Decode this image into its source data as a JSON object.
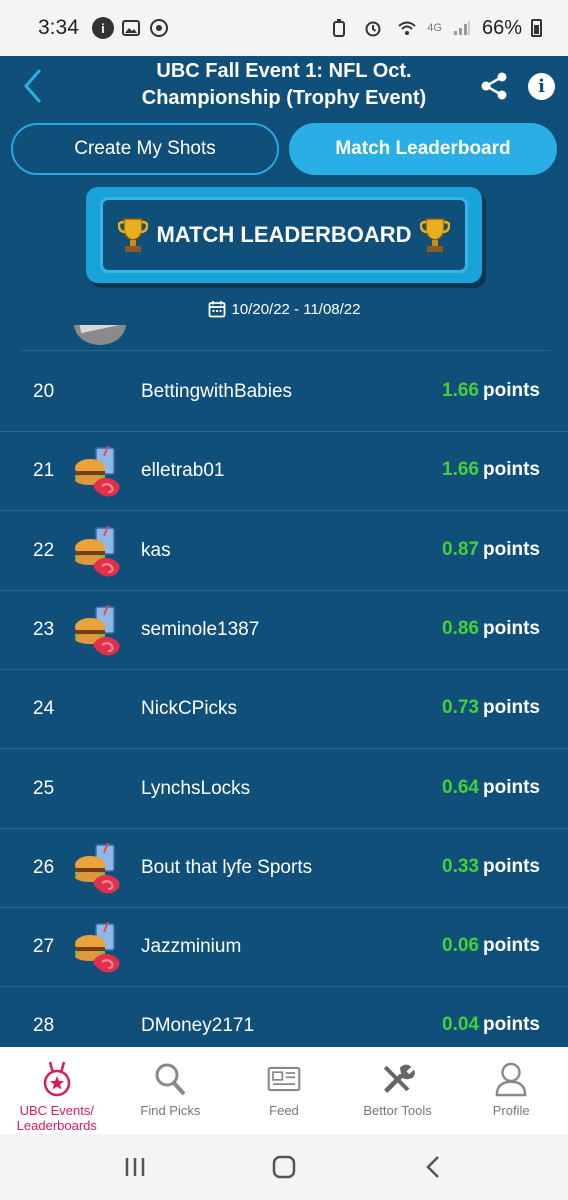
{
  "status_bar": {
    "time": "3:34",
    "network": "4G",
    "battery": "66%"
  },
  "header": {
    "title_line1": "UBC Fall Event 1: NFL Oct.",
    "title_line2": "Championship (Trophy Event)"
  },
  "tabs": [
    {
      "label": "Create My Shots",
      "active": false
    },
    {
      "label": "Match Leaderboard",
      "active": true
    }
  ],
  "banner": {
    "title": "MATCH LEADERBOARD"
  },
  "date_range": "10/20/22 - 11/08/22",
  "leaderboard": [
    {
      "rank": "20",
      "name": "BettingwithBabies",
      "points": "1.66",
      "unit": "points",
      "avatar": "none"
    },
    {
      "rank": "21",
      "name": "elletrab01",
      "points": "1.66",
      "unit": "points",
      "avatar": "food-icon"
    },
    {
      "rank": "22",
      "name": "kas",
      "points": "0.87",
      "unit": "points",
      "avatar": "food-icon"
    },
    {
      "rank": "23",
      "name": "seminole1387",
      "points": "0.86",
      "unit": "points",
      "avatar": "food-icon"
    },
    {
      "rank": "24",
      "name": "NickCPicks",
      "points": "0.73",
      "unit": "points",
      "avatar": "none"
    },
    {
      "rank": "25",
      "name": "LynchsLocks",
      "points": "0.64",
      "unit": "points",
      "avatar": "none"
    },
    {
      "rank": "26",
      "name": "Bout that lyfe Sports",
      "points": "0.33",
      "unit": "points",
      "avatar": "food-icon"
    },
    {
      "rank": "27",
      "name": "Jazzminium",
      "points": "0.06",
      "unit": "points",
      "avatar": "food-icon"
    },
    {
      "rank": "28",
      "name": "DMoney2171",
      "points": "0.04",
      "unit": "points",
      "avatar": "none"
    }
  ],
  "bottom_nav": [
    {
      "label_line1": "UBC Events/",
      "label_line2": "Leaderboards",
      "icon": "medal-icon",
      "active": true
    },
    {
      "label_line1": "Find Picks",
      "label_line2": "",
      "icon": "search-icon",
      "active": false
    },
    {
      "label_line1": "Feed",
      "label_line2": "",
      "icon": "newspaper-icon",
      "active": false
    },
    {
      "label_line1": "Bettor Tools",
      "label_line2": "",
      "icon": "tools-icon",
      "active": false
    },
    {
      "label_line1": "Profile",
      "label_line2": "",
      "icon": "profile-icon",
      "active": false
    }
  ],
  "colors": {
    "background": "#0f4f7a",
    "accent": "#29aee6",
    "points": "#45d03a",
    "nav_active": "#d91b5c"
  }
}
